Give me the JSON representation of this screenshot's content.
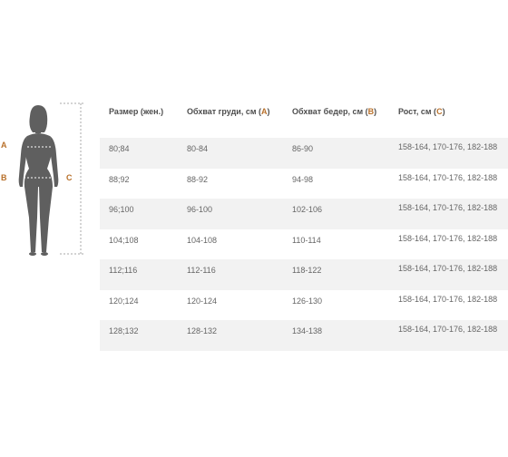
{
  "figure": {
    "labels": {
      "a": "A",
      "b": "B",
      "c": "C"
    },
    "colors": {
      "silhouette": "#5f5f5f",
      "accent": "#b8702a"
    }
  },
  "table": {
    "headers": {
      "size": "Размер (жен.)",
      "chest_text": "Обхват груди, см (",
      "chest_code": "A",
      "hips_text": "Обхват бедер, см (",
      "hips_code": "B",
      "height_text": "Рост, см (",
      "height_code": "C",
      "close": ")"
    },
    "rows": [
      {
        "size": "80;84",
        "chest": "80-84",
        "hips": "86-90",
        "height": "158-164, 170-176, 182-188"
      },
      {
        "size": "88;92",
        "chest": "88-92",
        "hips": "94-98",
        "height": "158-164, 170-176, 182-188"
      },
      {
        "size": "96;100",
        "chest": "96-100",
        "hips": "102-106",
        "height": "158-164, 170-176, 182-188"
      },
      {
        "size": "104;108",
        "chest": "104-108",
        "hips": "110-114",
        "height": "158-164, 170-176, 182-188"
      },
      {
        "size": "112;116",
        "chest": "112-116",
        "hips": "118-122",
        "height": "158-164, 170-176, 182-188"
      },
      {
        "size": "120;124",
        "chest": "120-124",
        "hips": "126-130",
        "height": "158-164, 170-176, 182-188"
      },
      {
        "size": "128;132",
        "chest": "128-132",
        "hips": "134-138",
        "height": "158-164, 170-176, 182-188"
      }
    ]
  }
}
